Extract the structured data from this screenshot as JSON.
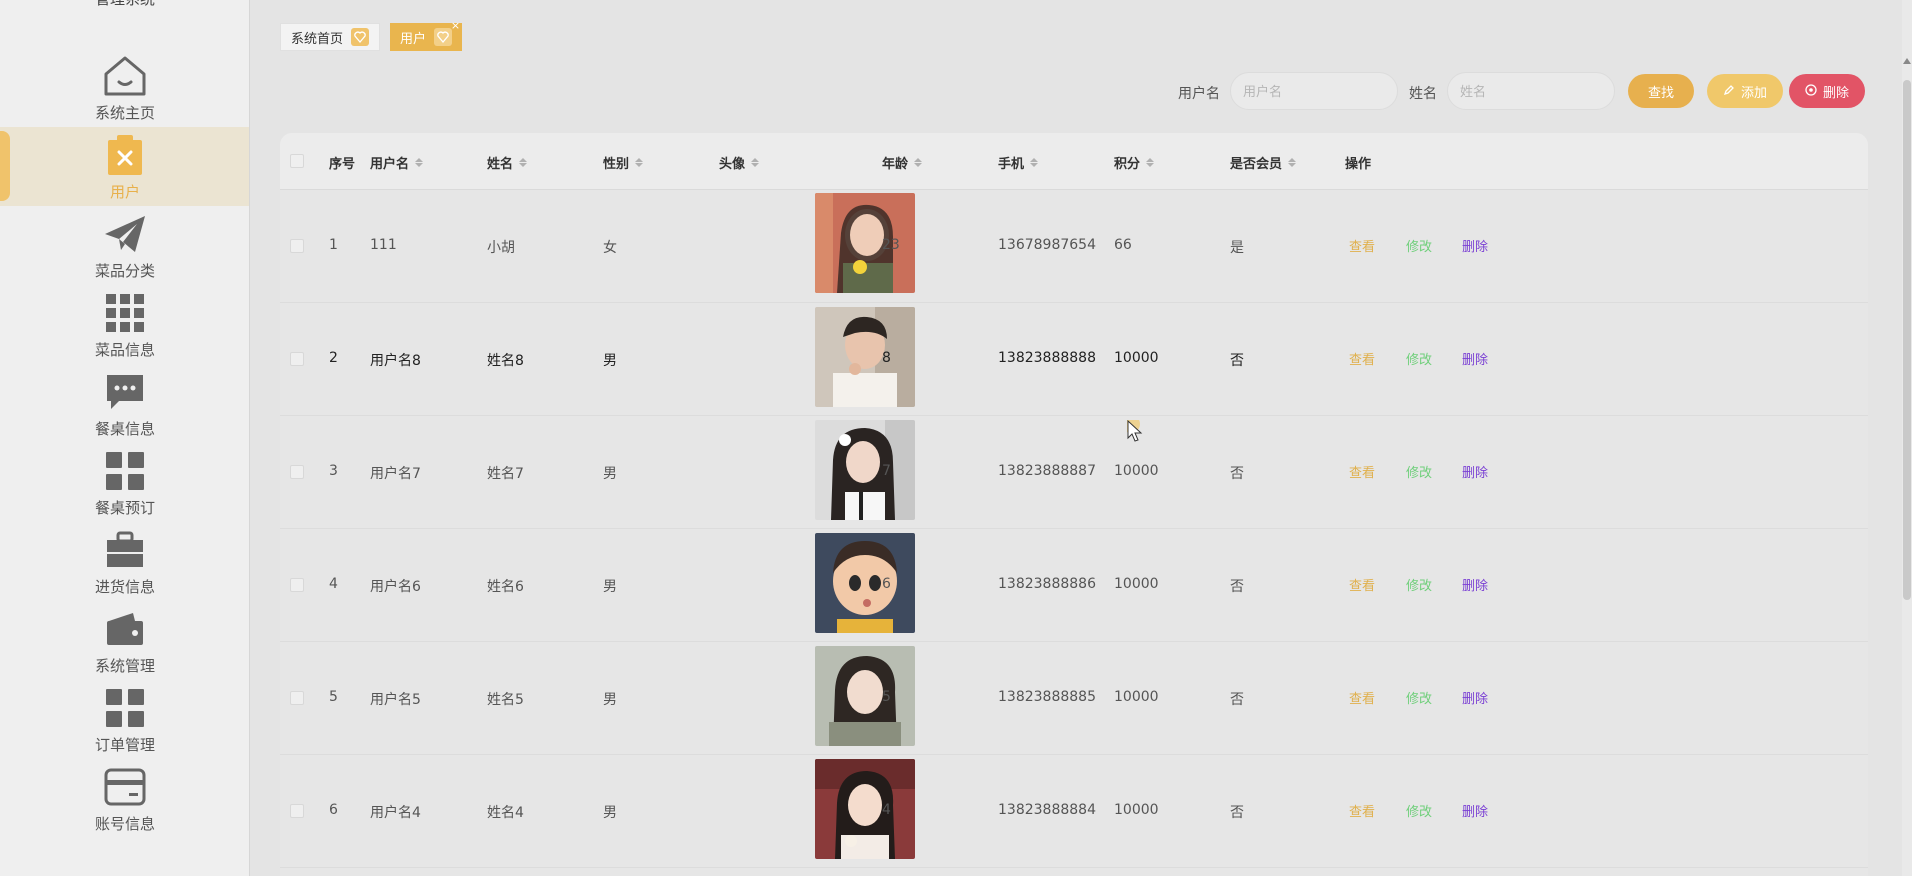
{
  "app": {
    "title": "管理系统"
  },
  "sidebar": {
    "items": [
      {
        "label": "系统主页",
        "icon": "home-icon"
      },
      {
        "label": "用户",
        "icon": "user-clipboard-icon",
        "active": true
      },
      {
        "label": "菜品分类",
        "icon": "paper-plane-icon"
      },
      {
        "label": "菜品信息",
        "icon": "grid-icon"
      },
      {
        "label": "餐桌信息",
        "icon": "chat-bubble-icon"
      },
      {
        "label": "餐桌预订",
        "icon": "tiles-icon"
      },
      {
        "label": "进货信息",
        "icon": "briefcase-icon"
      },
      {
        "label": "系统管理",
        "icon": "wallet-icon"
      },
      {
        "label": "订单管理",
        "icon": "tiles-icon"
      },
      {
        "label": "账号信息",
        "icon": "card-icon"
      }
    ]
  },
  "tabs": [
    {
      "label": "系统首页"
    },
    {
      "label": "用户",
      "closable": true
    }
  ],
  "search": {
    "username_label": "用户名",
    "username_placeholder": "用户名",
    "name_label": "姓名",
    "name_placeholder": "姓名",
    "find_label": "查找",
    "add_label": "添加",
    "delete_label": "删除"
  },
  "table": {
    "headers": {
      "index": "序号",
      "username": "用户名",
      "name": "姓名",
      "gender": "性别",
      "avatar": "头像",
      "age": "年龄",
      "phone": "手机",
      "points": "积分",
      "member": "是否会员",
      "actions": "操作"
    },
    "actions": {
      "view": "查看",
      "edit": "修改",
      "delete": "删除"
    },
    "rows": [
      {
        "index": "1",
        "username": "111",
        "name": "小胡",
        "gender": "女",
        "age": "23",
        "phone": "13678987654",
        "points": "66",
        "member": "是"
      },
      {
        "index": "2",
        "username": "用户名8",
        "name": "姓名8",
        "gender": "男",
        "age": "8",
        "phone": "13823888888",
        "points": "10000",
        "member": "否"
      },
      {
        "index": "3",
        "username": "用户名7",
        "name": "姓名7",
        "gender": "男",
        "age": "7",
        "phone": "13823888887",
        "points": "10000",
        "member": "否"
      },
      {
        "index": "4",
        "username": "用户名6",
        "name": "姓名6",
        "gender": "男",
        "age": "6",
        "phone": "13823888886",
        "points": "10000",
        "member": "否"
      },
      {
        "index": "5",
        "username": "用户名5",
        "name": "姓名5",
        "gender": "男",
        "age": "5",
        "phone": "13823888885",
        "points": "10000",
        "member": "否"
      },
      {
        "index": "6",
        "username": "用户名4",
        "name": "姓名4",
        "gender": "男",
        "age": "4",
        "phone": "13823888884",
        "points": "10000",
        "member": "否"
      }
    ]
  },
  "colors": {
    "accent": "#e9b54e",
    "danger": "#e25466",
    "view": "#e0b04c",
    "edit": "#6fcf7a",
    "delete": "#7a3fd4"
  }
}
